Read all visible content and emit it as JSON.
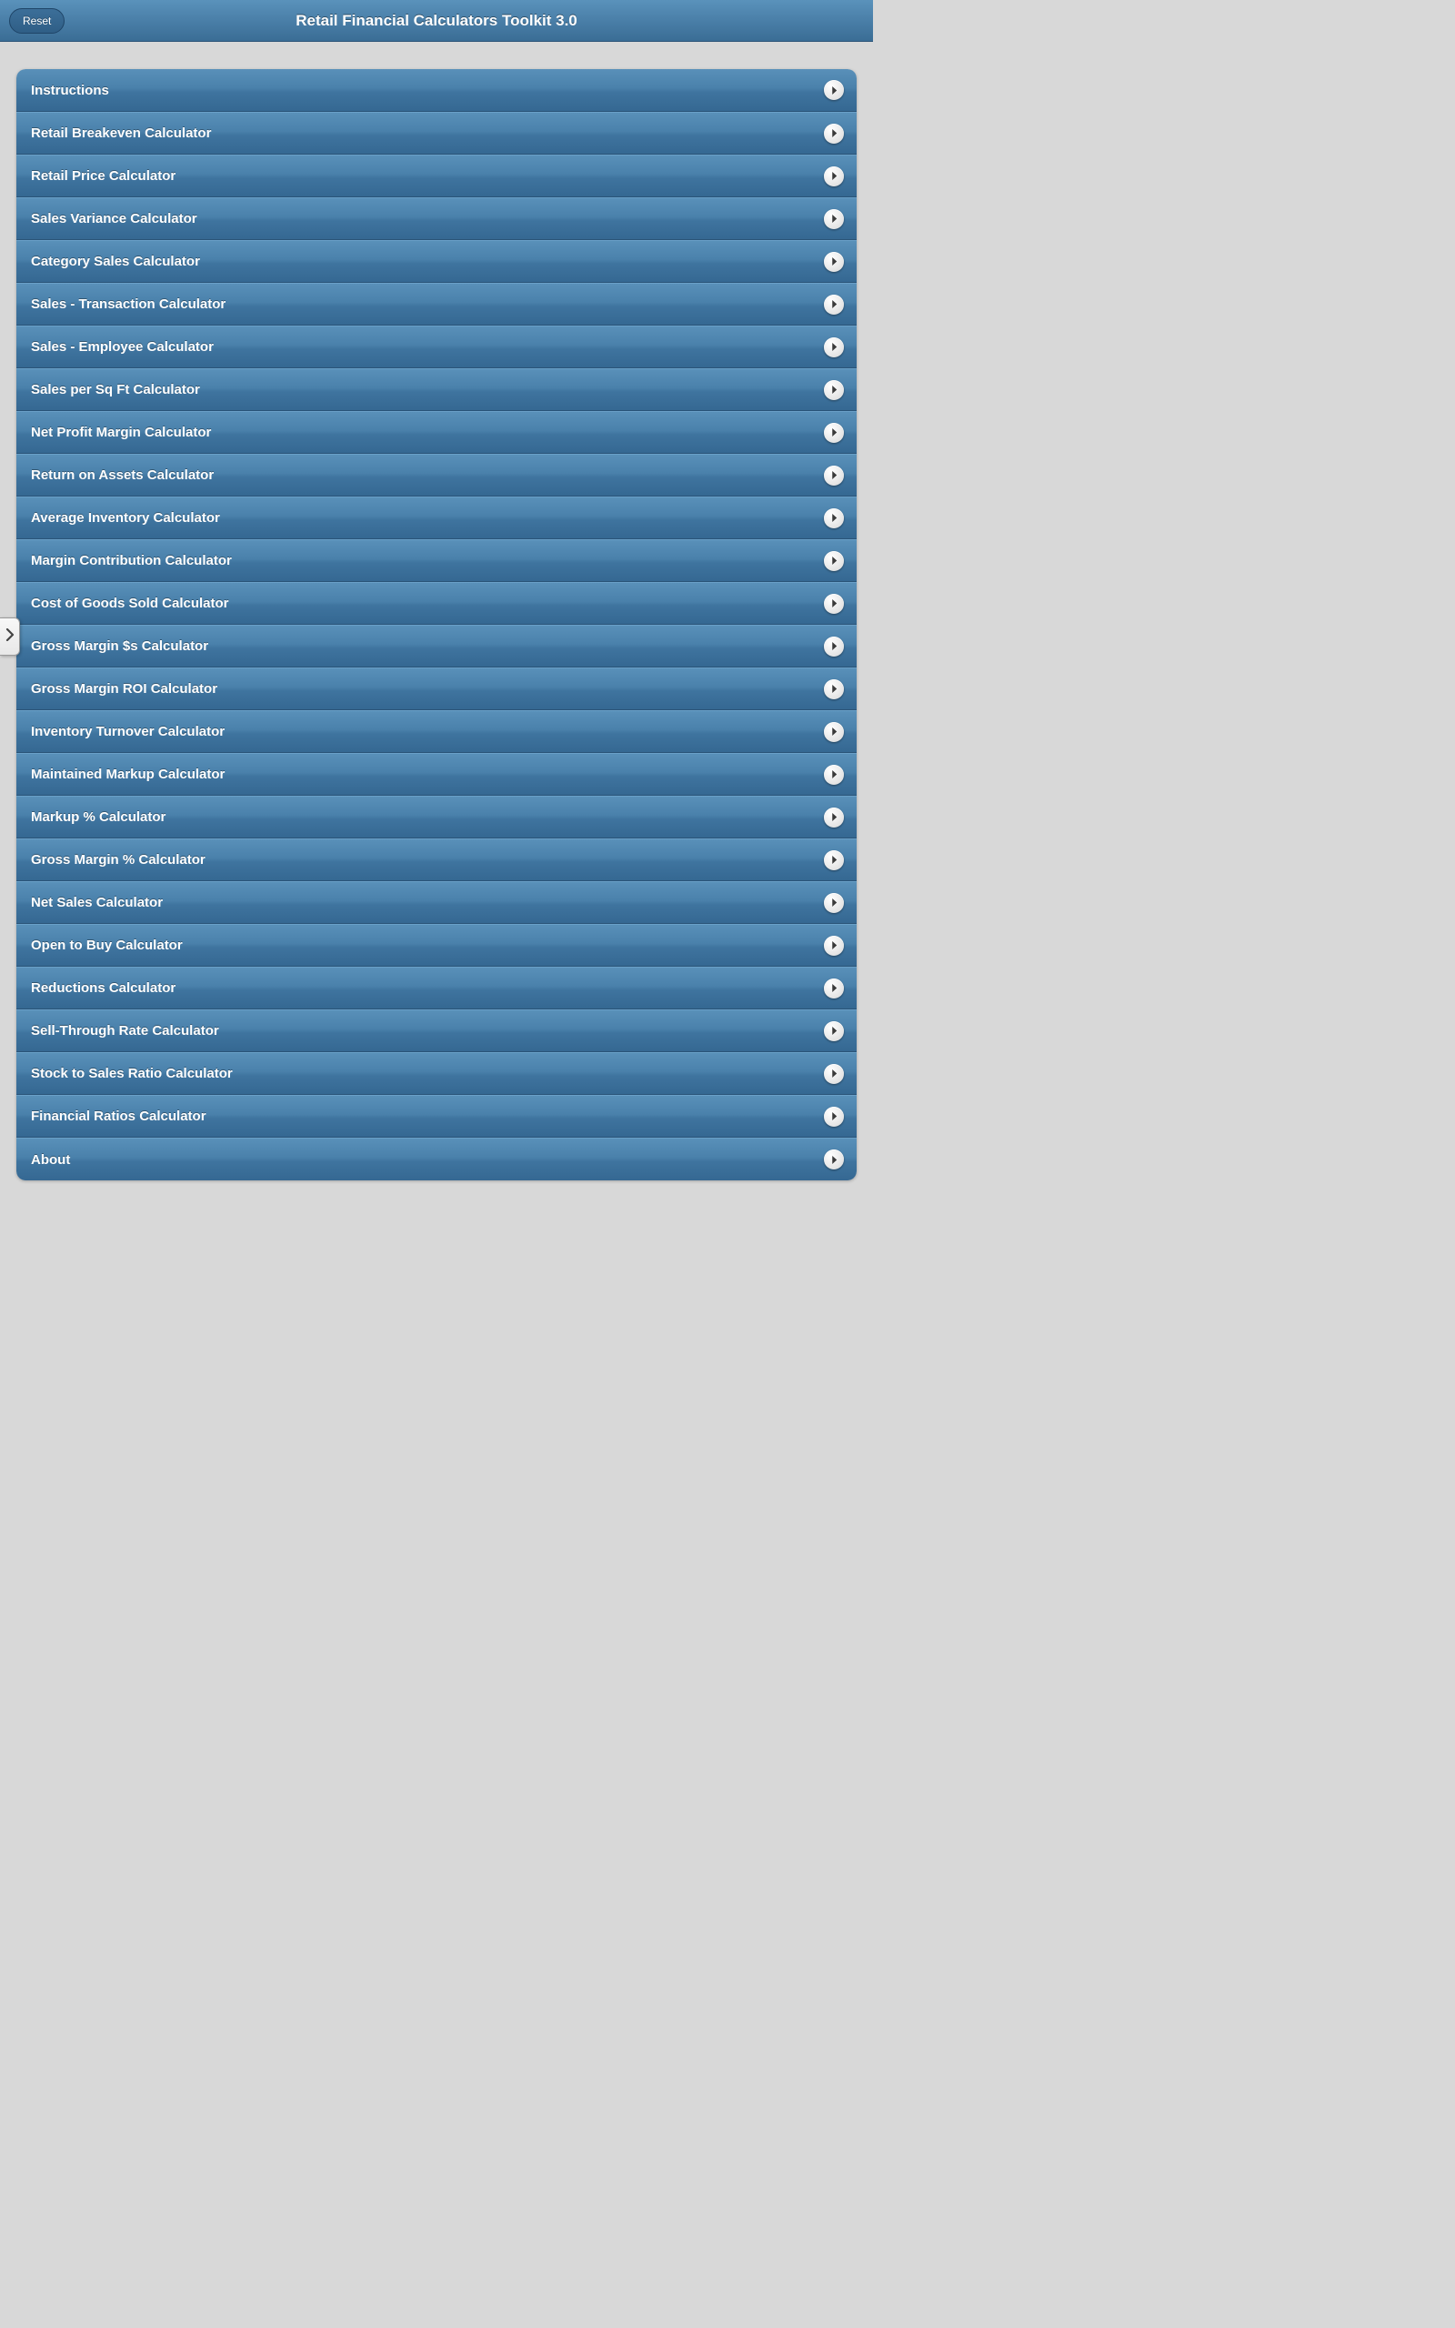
{
  "header": {
    "title": "Retail Financial Calculators Toolkit 3.0",
    "reset_label": "Reset"
  },
  "menu": {
    "items": [
      {
        "label": "Instructions"
      },
      {
        "label": "Retail Breakeven Calculator"
      },
      {
        "label": "Retail Price Calculator"
      },
      {
        "label": "Sales Variance Calculator"
      },
      {
        "label": "Category Sales Calculator"
      },
      {
        "label": "Sales - Transaction Calculator"
      },
      {
        "label": "Sales - Employee Calculator"
      },
      {
        "label": "Sales per Sq Ft Calculator"
      },
      {
        "label": "Net Profit Margin Calculator"
      },
      {
        "label": "Return on Assets Calculator"
      },
      {
        "label": "Average Inventory Calculator"
      },
      {
        "label": "Margin Contribution Calculator"
      },
      {
        "label": "Cost of Goods Sold Calculator"
      },
      {
        "label": "Gross Margin $s Calculator"
      },
      {
        "label": "Gross Margin ROI Calculator"
      },
      {
        "label": "Inventory Turnover Calculator"
      },
      {
        "label": "Maintained Markup Calculator"
      },
      {
        "label": "Markup % Calculator"
      },
      {
        "label": "Gross Margin % Calculator"
      },
      {
        "label": "Net Sales Calculator"
      },
      {
        "label": "Open to Buy Calculator"
      },
      {
        "label": "Reductions Calculator"
      },
      {
        "label": "Sell-Through Rate Calculator"
      },
      {
        "label": "Stock to Sales Ratio Calculator"
      },
      {
        "label": "Financial Ratios Calculator"
      },
      {
        "label": "About"
      }
    ]
  }
}
